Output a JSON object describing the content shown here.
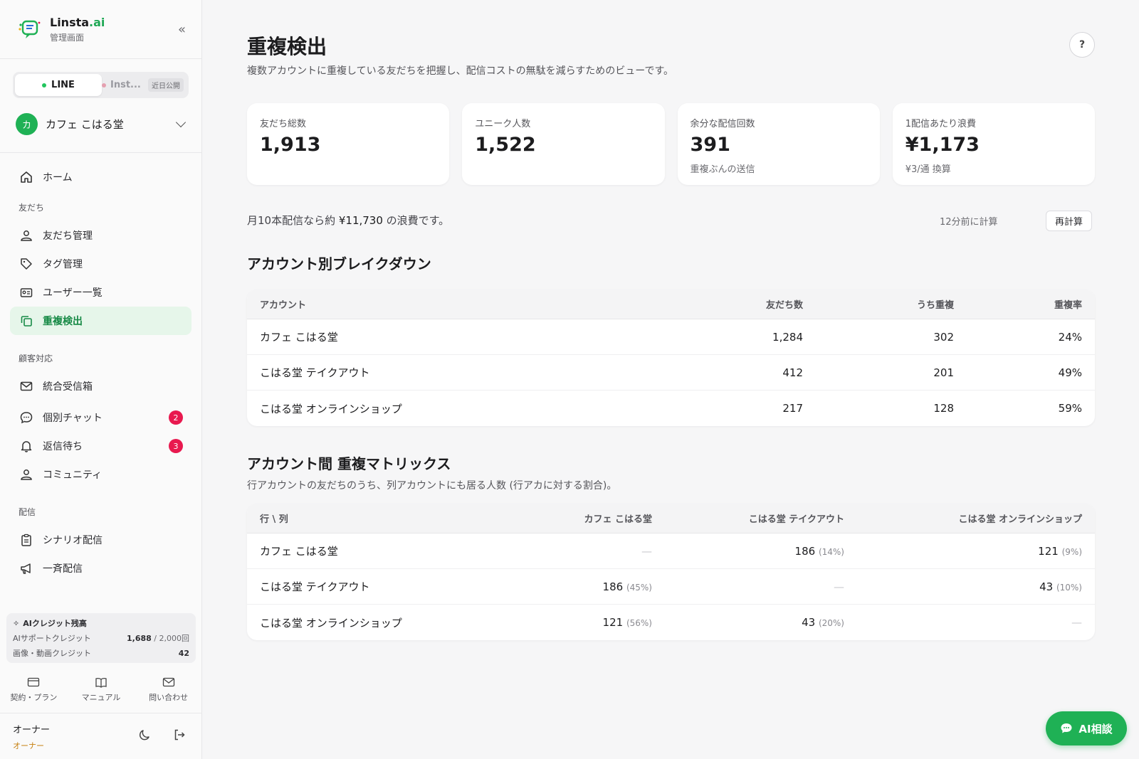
{
  "brand": {
    "name_main": "Linsta",
    "name_suffix": ".ai",
    "subtitle": "管理画面"
  },
  "channels": {
    "line": "LINE",
    "instagram": "Inst...",
    "soon": "近日公開"
  },
  "account": {
    "avatar": "カ",
    "name": "カフェ こはる堂"
  },
  "nav": {
    "home": "ホーム",
    "section_friends": "友だち",
    "friends_manage": "友だち管理",
    "tag_manage": "タグ管理",
    "user_list": "ユーザー一覧",
    "duplicate": "重複検出",
    "section_support": "顧客対応",
    "inbox": "統合受信箱",
    "chat": "個別チャット",
    "chat_badge": "2",
    "waiting": "返信待ち",
    "waiting_badge": "3",
    "community": "コミュニティ",
    "section_delivery": "配信",
    "scenario": "シナリオ配信",
    "broadcast": "一斉配信"
  },
  "credits": {
    "title": "AIクレジット残高",
    "support_label": "AIサポートクレジット",
    "support_value": "1,688",
    "support_total": " / 2,000回",
    "media_label": "画像・動画クレジット",
    "media_value": "42"
  },
  "links": {
    "plan": "契約・プラン",
    "manual": "マニュアル",
    "contact": "問い合わせ"
  },
  "user": {
    "name": "オーナー",
    "role": "オーナー"
  },
  "page": {
    "title": "重複検出",
    "description": "複数アカウントに重複している友だちを把握し、配信コストの無駄を減らすためのビューです。",
    "help": "?"
  },
  "stats": [
    {
      "label": "友だち総数",
      "value": "1,913",
      "note": ""
    },
    {
      "label": "ユニーク人数",
      "value": "1,522",
      "note": ""
    },
    {
      "label": "余分な配信回数",
      "value": "391",
      "note": "重複ぶんの送信"
    },
    {
      "label": "1配信あたり浪費",
      "value": "¥1,173",
      "note": "¥3/通 換算"
    }
  ],
  "waste": {
    "prefix": "月10本配信なら約 ",
    "amount": "¥11,730",
    "suffix": " の浪費です。",
    "calc_time": "12分前に計算",
    "recalc": "再計算"
  },
  "breakdown": {
    "title": "アカウント別ブレイクダウン",
    "headers": [
      "アカウント",
      "友だち数",
      "うち重複",
      "重複率"
    ],
    "rows": [
      [
        "カフェ こはる堂",
        "1,284",
        "302",
        "24%"
      ],
      [
        "こはる堂 テイクアウト",
        "412",
        "201",
        "49%"
      ],
      [
        "こはる堂 オンラインショップ",
        "217",
        "128",
        "59%"
      ]
    ]
  },
  "matrix": {
    "title": "アカウント間 重複マトリックス",
    "description": "行アカウントの友だちのうち、列アカウントにも居る人数 (行アカに対する割合)。",
    "headers": [
      "行 \\ 列",
      "カフェ こはる堂",
      "こはる堂 テイクアウト",
      "こはる堂 オンラインショップ"
    ],
    "rows": [
      {
        "name": "カフェ こはる堂",
        "cells": [
          {
            "v": "—",
            "p": ""
          },
          {
            "v": "186",
            "p": "(14%)"
          },
          {
            "v": "121",
            "p": "(9%)"
          }
        ]
      },
      {
        "name": "こはる堂 テイクアウト",
        "cells": [
          {
            "v": "186",
            "p": "(45%)"
          },
          {
            "v": "—",
            "p": ""
          },
          {
            "v": "43",
            "p": "(10%)"
          }
        ]
      },
      {
        "name": "こはる堂 オンラインショップ",
        "cells": [
          {
            "v": "121",
            "p": "(56%)"
          },
          {
            "v": "43",
            "p": "(20%)"
          },
          {
            "v": "—",
            "p": ""
          }
        ]
      }
    ]
  },
  "ai_button": "AI相談",
  "colors": {
    "accent": "#1fb155",
    "active_bg": "#e6f6ea",
    "badge": "#e8194f",
    "role": "#c68010"
  }
}
